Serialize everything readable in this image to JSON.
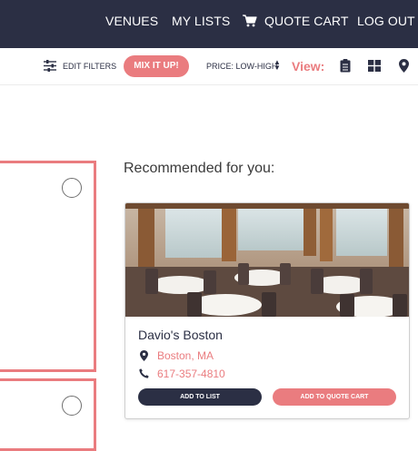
{
  "nav": {
    "venues": "VENUES",
    "my_lists": "MY LISTS",
    "quote_cart": "QUOTE CART",
    "log_out": "LOG OUT",
    "cart_icon": "cart-icon"
  },
  "toolbar": {
    "edit_filters": "EDIT FILTERS",
    "filters_icon": "sliders-icon",
    "mix_it_up": "MIX IT UP!",
    "price_sort": "PRICE: LOW-HIGH",
    "sort_arrows": "sort-arrows-icon",
    "view_label": "View:",
    "view_icons": [
      "clipboard-list-icon",
      "grid-icon",
      "map-pin-icon"
    ]
  },
  "recommendations": {
    "heading": "Recommended for you:",
    "card": {
      "name": "Davio's Boston",
      "location": "Boston, MA",
      "phone": "617-357-4810",
      "add_to_list": "ADD TO LIST",
      "add_to_quote_cart": "ADD TO QUOTE CART"
    }
  },
  "colors": {
    "navy": "#2b2f44",
    "coral": "#ea7c7f",
    "white": "#ffffff"
  }
}
